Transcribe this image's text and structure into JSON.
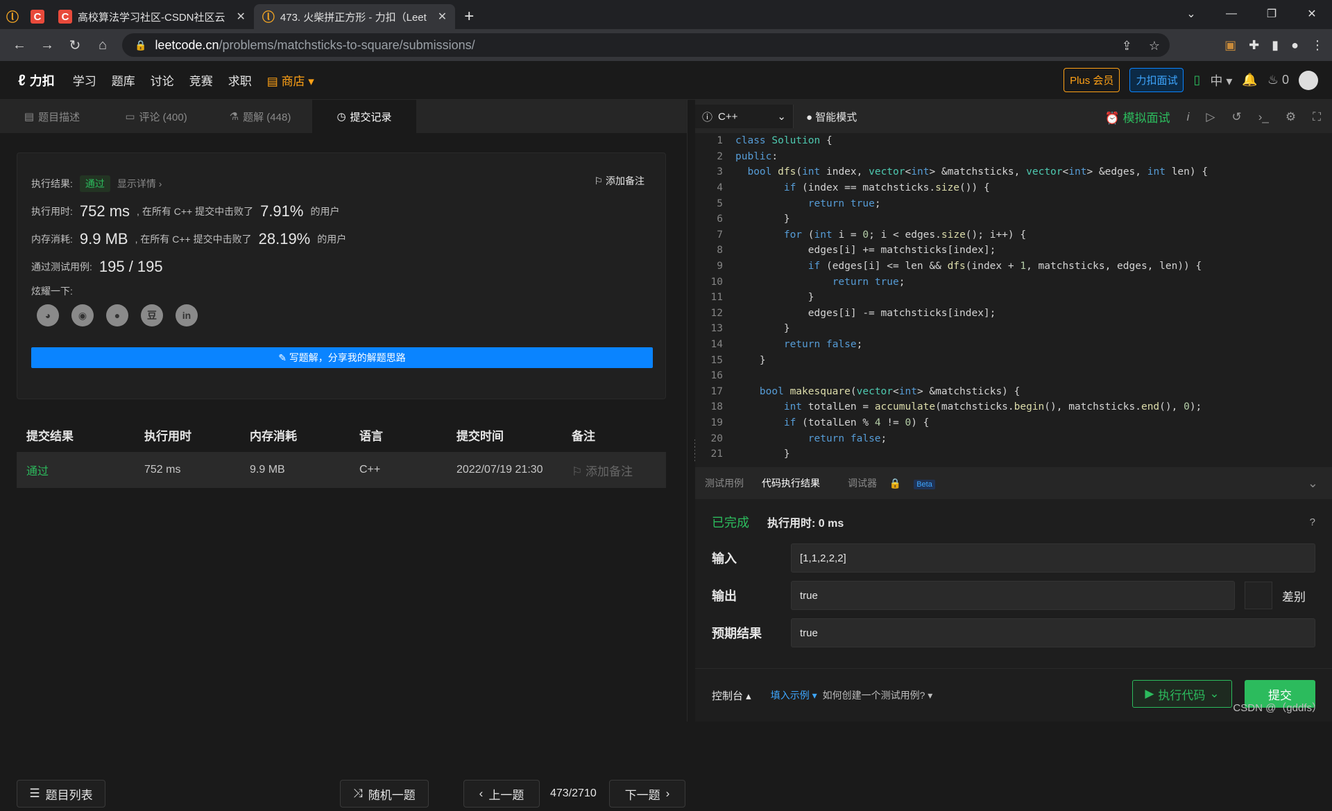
{
  "browser": {
    "tabs": [
      {
        "title": "高校算法学习社区-CSDN社区云",
        "favicon": "csdn"
      },
      {
        "title": "473. 火柴拼正方形 - 力扣（Leet",
        "favicon": "leetcode"
      }
    ],
    "url_host": "leetcode.cn",
    "url_path": "/problems/matchsticks-to-square/submissions/"
  },
  "lc_nav": {
    "logo": "力扣",
    "links": [
      "学习",
      "题库",
      "讨论",
      "竞赛",
      "求职"
    ],
    "store": "商店",
    "plus": "Plus 会员",
    "interview": "力扣面试",
    "lang": "中",
    "fire_count": "0"
  },
  "left_tabs": [
    "题目描述",
    "评论 (400)",
    "题解 (448)",
    "提交记录"
  ],
  "result": {
    "label": "执行结果:",
    "status": "通过",
    "details": "显示详情 ›",
    "add_note": "添加备注",
    "time_label": "执行用时:",
    "time_value": "752 ms",
    "time_text": ", 在所有 C++ 提交中击败了",
    "time_pct": "7.91%",
    "mem_label": "内存消耗:",
    "mem_value": "9.9 MB",
    "mem_text": ", 在所有 C++ 提交中击败了",
    "mem_pct": "28.19%",
    "users": "的用户",
    "tests_label": "通过测试用例:",
    "tests_value": "195 / 195",
    "share_label": "炫耀一下:",
    "write_btn": "写题解，分享我的解题思路"
  },
  "submissions": {
    "headers": [
      "提交结果",
      "执行用时",
      "内存消耗",
      "语言",
      "提交时间",
      "备注"
    ],
    "rows": [
      {
        "result": "通过",
        "time": "752 ms",
        "mem": "9.9 MB",
        "lang": "C++",
        "date": "2022/07/19 21:30",
        "note": "添加备注"
      }
    ]
  },
  "bottom": {
    "list": "题目列表",
    "random": "随机一题",
    "prev": "上一题",
    "counter": "473/2710",
    "next": "下一题"
  },
  "editor": {
    "language": "C++",
    "mode": "智能模式",
    "mock": "模拟面试",
    "lines": [
      "class Solution {",
      "public:",
      "  bool dfs(int index, vector<int> &matchsticks, vector<int> &edges, int len) {",
      "        if (index == matchsticks.size()) {",
      "            return true;",
      "        }",
      "        for (int i = 0; i < edges.size(); i++) {",
      "            edges[i] += matchsticks[index];",
      "            if (edges[i] <= len && dfs(index + 1, matchsticks, edges, len)) {",
      "                return true;",
      "            }",
      "            edges[i] -= matchsticks[index];",
      "        }",
      "        return false;",
      "    }",
      "",
      "    bool makesquare(vector<int> &matchsticks) {",
      "        int totalLen = accumulate(matchsticks.begin(), matchsticks.end(), 0);",
      "        if (totalLen % 4 != 0) {",
      "            return false;",
      "        }"
    ]
  },
  "results": {
    "tabs": [
      "测试用例",
      "代码执行结果",
      "调试器"
    ],
    "beta": "Beta",
    "status": "已完成",
    "time": "执行用时: 0 ms",
    "input_label": "输入",
    "input": "[1,1,2,2,2]",
    "output_label": "输出",
    "output": "true",
    "diff": "差别",
    "expected_label": "预期结果",
    "expected": "true"
  },
  "console": {
    "label": "控制台 ▴",
    "fill_example": "填入示例 ▾",
    "how_to": "如何创建一个测试用例? ▾",
    "run": "执行代码",
    "submit": "提交",
    "watermark": "CSDN @（gddfs）"
  }
}
